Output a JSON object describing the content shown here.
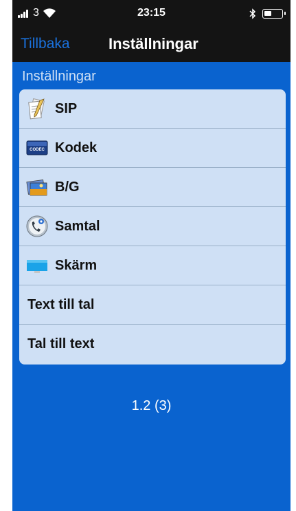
{
  "status_bar": {
    "carrier": "3",
    "time": "23:15"
  },
  "nav": {
    "back_label": "Tillbaka",
    "title": "Inställningar"
  },
  "section": {
    "header": "Inställningar"
  },
  "settings": {
    "items": [
      {
        "label": "SIP",
        "icon": "sip-icon"
      },
      {
        "label": "Kodek",
        "icon": "codec-icon"
      },
      {
        "label": "B/G",
        "icon": "background-image-icon"
      },
      {
        "label": "Samtal",
        "icon": "call-settings-icon"
      },
      {
        "label": "Skärm",
        "icon": "screen-icon"
      },
      {
        "label": "Text till tal",
        "icon": ""
      },
      {
        "label": "Tal till text",
        "icon": ""
      }
    ]
  },
  "codec_icon_text": "CODEC",
  "version": "1.2 (3)",
  "colors": {
    "background": "#0a63cf",
    "bar": "#141414",
    "list": "#cfe0f5",
    "back_link": "#1a72de"
  }
}
